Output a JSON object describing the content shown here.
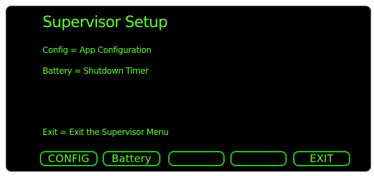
{
  "screen": {
    "title": "Supervisor Setup",
    "lines": {
      "config": "Config  = App Configuration",
      "battery": "Battery = Shutdown Timer",
      "exit": "Exit   = Exit the Supervisor Menu"
    }
  },
  "softkeys": {
    "config": "CONFIG",
    "battery": "Battery",
    "blank1": "",
    "blank2": "",
    "exit": "EXIT"
  },
  "colors": {
    "text": "#5cff2a",
    "border": "#28c01e",
    "background": "#000000"
  }
}
